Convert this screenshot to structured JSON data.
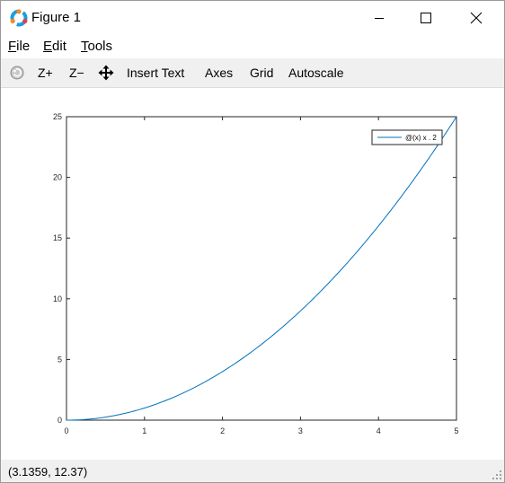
{
  "window": {
    "title": "Figure 1"
  },
  "menu": [
    {
      "accel": "F",
      "rest": "ile"
    },
    {
      "accel": "E",
      "rest": "dit"
    },
    {
      "accel": "T",
      "rest": "ools"
    }
  ],
  "toolbar": {
    "zoom_in": "Z+",
    "zoom_out": "Z−",
    "insert_text": "Insert Text",
    "axes": "Axes",
    "grid": "Grid",
    "autoscale": "Autoscale"
  },
  "status": {
    "coordinates": "(3.1359, 12.37)"
  },
  "colors": {
    "line": "#0072bd",
    "toolbar_bg": "#f0f0f0"
  },
  "chart_data": {
    "type": "line",
    "function": "x.^2",
    "x_range": [
      0,
      5
    ],
    "xlim": [
      0,
      5
    ],
    "ylim": [
      0,
      25
    ],
    "x_ticks": [
      "0",
      "1",
      "2",
      "3",
      "4",
      "5"
    ],
    "y_ticks": [
      "0",
      "5",
      "10",
      "15",
      "20",
      "25"
    ],
    "series": [
      {
        "name": "@(x) x . 2",
        "color": "#0072bd"
      }
    ],
    "legend": "top-right",
    "grid": false
  }
}
